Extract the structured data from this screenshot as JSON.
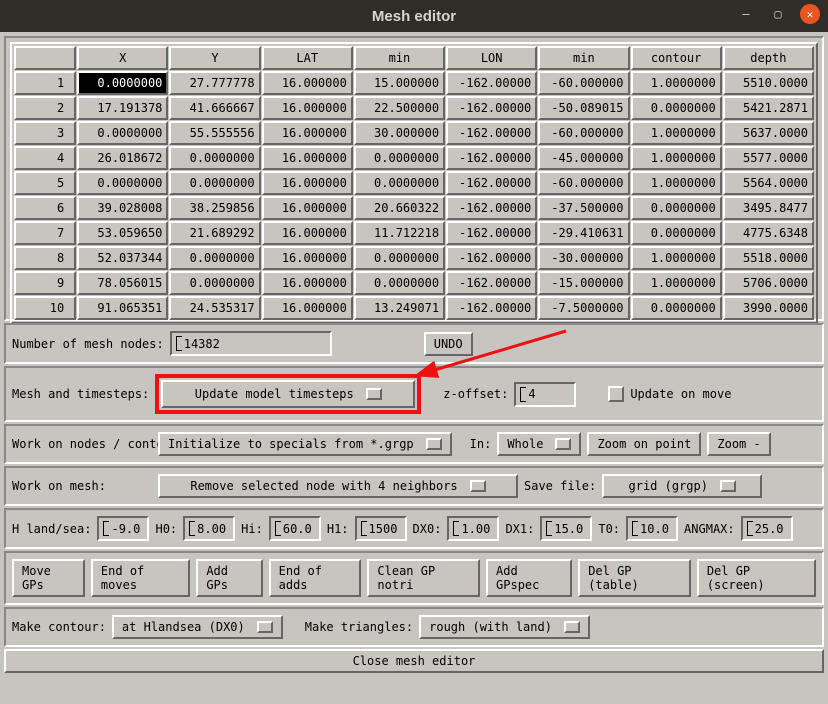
{
  "title": "Mesh editor",
  "table": {
    "headers": [
      "",
      "X",
      "Y",
      "LAT",
      "min",
      "LON",
      "min",
      "contour",
      "depth"
    ],
    "rows": [
      {
        "n": "1",
        "x": "0.0000000",
        "y": "27.777778",
        "lat": "16.000000",
        "latm": "15.000000",
        "lon": "-162.00000",
        "lonm": "-60.000000",
        "c": "1.0000000",
        "d": "5510.0000"
      },
      {
        "n": "2",
        "x": "17.191378",
        "y": "41.666667",
        "lat": "16.000000",
        "latm": "22.500000",
        "lon": "-162.00000",
        "lonm": "-50.089015",
        "c": "0.0000000",
        "d": "5421.2871"
      },
      {
        "n": "3",
        "x": "0.0000000",
        "y": "55.555556",
        "lat": "16.000000",
        "latm": "30.000000",
        "lon": "-162.00000",
        "lonm": "-60.000000",
        "c": "1.0000000",
        "d": "5637.0000"
      },
      {
        "n": "4",
        "x": "26.018672",
        "y": "0.0000000",
        "lat": "16.000000",
        "latm": "0.0000000",
        "lon": "-162.00000",
        "lonm": "-45.000000",
        "c": "1.0000000",
        "d": "5577.0000"
      },
      {
        "n": "5",
        "x": "0.0000000",
        "y": "0.0000000",
        "lat": "16.000000",
        "latm": "0.0000000",
        "lon": "-162.00000",
        "lonm": "-60.000000",
        "c": "1.0000000",
        "d": "5564.0000"
      },
      {
        "n": "6",
        "x": "39.028008",
        "y": "38.259856",
        "lat": "16.000000",
        "latm": "20.660322",
        "lon": "-162.00000",
        "lonm": "-37.500000",
        "c": "0.0000000",
        "d": "3495.8477"
      },
      {
        "n": "7",
        "x": "53.059650",
        "y": "21.689292",
        "lat": "16.000000",
        "latm": "11.712218",
        "lon": "-162.00000",
        "lonm": "-29.410631",
        "c": "0.0000000",
        "d": "4775.6348"
      },
      {
        "n": "8",
        "x": "52.037344",
        "y": "0.0000000",
        "lat": "16.000000",
        "latm": "0.0000000",
        "lon": "-162.00000",
        "lonm": "-30.000000",
        "c": "1.0000000",
        "d": "5518.0000"
      },
      {
        "n": "9",
        "x": "78.056015",
        "y": "0.0000000",
        "lat": "16.000000",
        "latm": "0.0000000",
        "lon": "-162.00000",
        "lonm": "-15.000000",
        "c": "1.0000000",
        "d": "5706.0000"
      },
      {
        "n": "10",
        "x": "91.065351",
        "y": "24.535317",
        "lat": "16.000000",
        "latm": "13.249071",
        "lon": "-162.00000",
        "lonm": "-7.5000000",
        "c": "0.0000000",
        "d": "3990.0000"
      }
    ]
  },
  "numNodes": {
    "label": "Number of mesh nodes:",
    "value": "14382",
    "undo": "UNDO"
  },
  "meshTs": {
    "label": "Mesh and timesteps:",
    "update": "Update model timesteps",
    "zoffLabel": "z-offset:",
    "zoffVal": "4",
    "updMove": "Update on move"
  },
  "workNodes": {
    "label": "Work on nodes / contour:",
    "init": "Initialize to specials from *.grgp",
    "inLabel": "In:",
    "inVal": "Whole",
    "zoomPt": "Zoom on point",
    "zoomMinus": "Zoom -"
  },
  "workMesh": {
    "label": "Work on mesh:",
    "remove": "Remove selected node with 4 neighbors",
    "saveLabel": "Save file:",
    "saveVal": "grid (grgp)"
  },
  "params": {
    "hls": {
      "l": "H land/sea:",
      "v": "-9.0"
    },
    "h0": {
      "l": "H0:",
      "v": "8.00"
    },
    "hi": {
      "l": "Hi:",
      "v": "60.0"
    },
    "h1": {
      "l": "H1:",
      "v": "1500"
    },
    "dx0": {
      "l": "DX0:",
      "v": "1.00"
    },
    "dx1": {
      "l": "DX1:",
      "v": "15.0"
    },
    "t0": {
      "l": "T0:",
      "v": "10.0"
    },
    "ang": {
      "l": "ANGMAX:",
      "v": "25.0"
    }
  },
  "gpbtns": {
    "move": "Move GPs",
    "endm": "End of moves",
    "add": "Add GPs",
    "enda": "End of adds",
    "clean": "Clean GP notri",
    "spec": "Add GPspec",
    "delt": "Del GP (table)",
    "dels": "Del GP (screen)"
  },
  "contour": {
    "label": "Make contour:",
    "val": "at Hlandsea (DX0)",
    "triLabel": "Make triangles:",
    "triVal": "rough (with land)"
  },
  "close": "Close mesh editor"
}
